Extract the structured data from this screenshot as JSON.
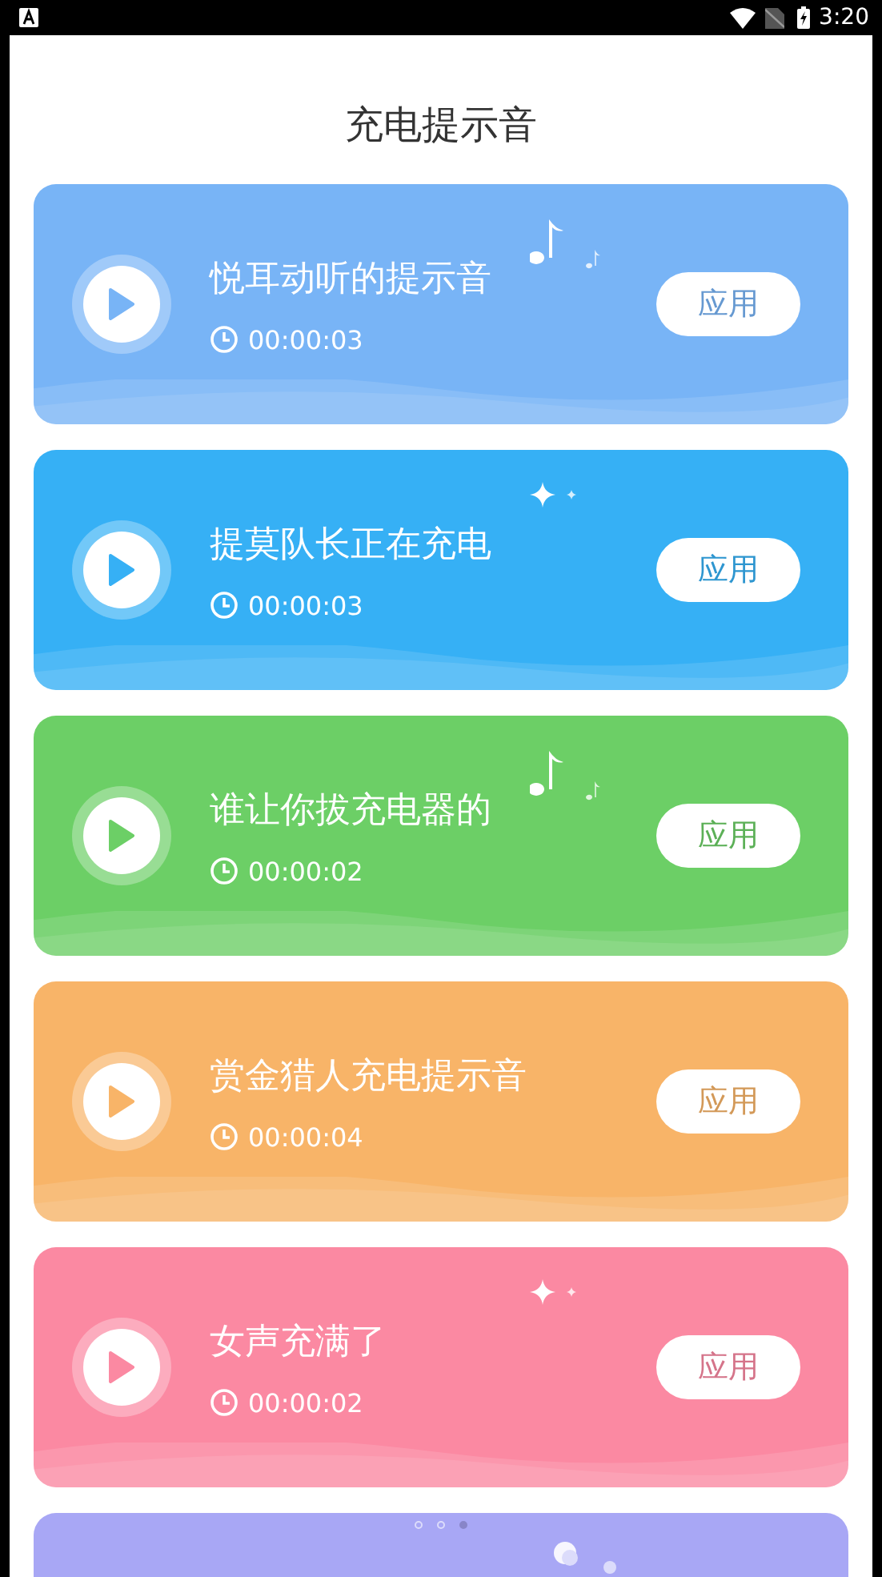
{
  "status_bar": {
    "time": "3:20"
  },
  "title": "充电提示音",
  "cards": [
    {
      "name": "悦耳动听的提示音",
      "duration": "00:00:03",
      "button": "应用",
      "color": "#78b4f6",
      "kind": "notes"
    },
    {
      "name": "提莫队长正在充电",
      "duration": "00:00:03",
      "button": "应用",
      "color": "#36b0f5",
      "kind": "sparkles"
    },
    {
      "name": "谁让你拔充电器的",
      "duration": "00:00:02",
      "button": "应用",
      "color": "#6ccf66",
      "kind": "notes"
    },
    {
      "name": "赏金猎人充电提示音",
      "duration": "00:00:04",
      "button": "应用",
      "color": "#f8b468"
    },
    {
      "name": "女声充满了",
      "duration": "00:00:02",
      "button": "应用",
      "color": "#fb89a2",
      "kind": "sparkles"
    },
    {
      "color": "#a8a7f5",
      "kind": "bubbles"
    }
  ],
  "page_dots": [
    {
      "selected": false
    },
    {
      "selected": false
    },
    {
      "selected": true
    }
  ]
}
